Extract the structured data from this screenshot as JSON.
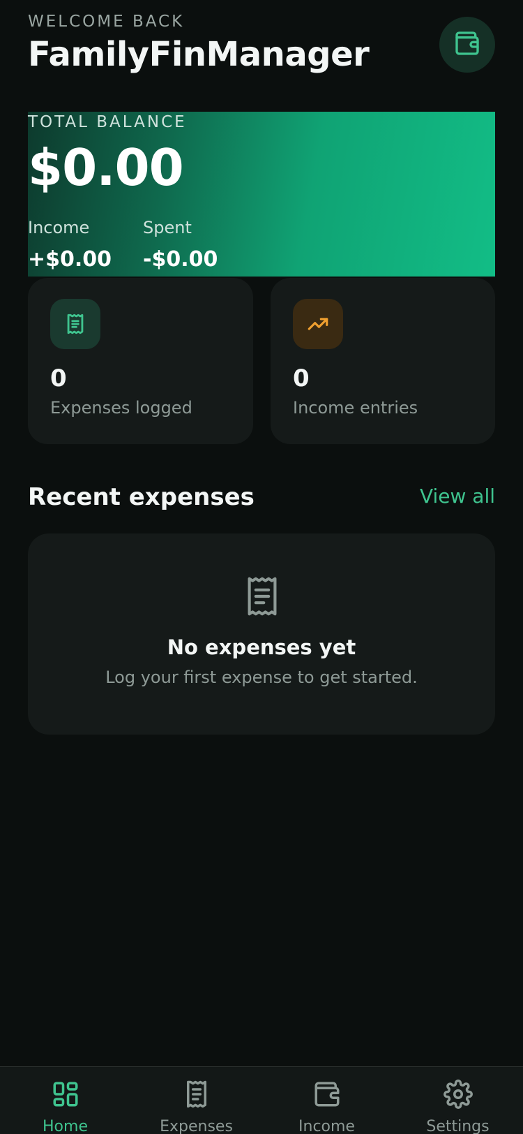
{
  "header": {
    "welcome": "WELCOME BACK",
    "title": "FamilyFinManager",
    "wallet_icon": "wallet-icon"
  },
  "balance": {
    "label": "TOTAL BALANCE",
    "value": "$0.00",
    "income_label": "Income",
    "income_value": "+$0.00",
    "spent_label": "Spent",
    "spent_value": "-$0.00"
  },
  "stats": [
    {
      "icon": "receipt-icon",
      "value": "0",
      "label": "Expenses logged",
      "color": "#3fc48f"
    },
    {
      "icon": "trending-up-icon",
      "value": "0",
      "label": "Income entries",
      "color": "#f0a030"
    }
  ],
  "recent": {
    "title": "Recent expenses",
    "view_all": "View all",
    "empty_icon": "receipt-icon",
    "empty_title": "No expenses yet",
    "empty_subtitle": "Log your first expense to get started."
  },
  "nav": {
    "items": [
      {
        "label": "Home",
        "icon": "grid-icon",
        "active": true
      },
      {
        "label": "Expenses",
        "icon": "receipt-icon",
        "active": false
      },
      {
        "label": "Income",
        "icon": "wallet-icon",
        "active": false
      },
      {
        "label": "Settings",
        "icon": "gear-icon",
        "active": false
      }
    ]
  },
  "colors": {
    "background": "#0b0f0e",
    "card": "#151a19",
    "accent": "#3fc48f",
    "income_accent": "#f0a030"
  }
}
